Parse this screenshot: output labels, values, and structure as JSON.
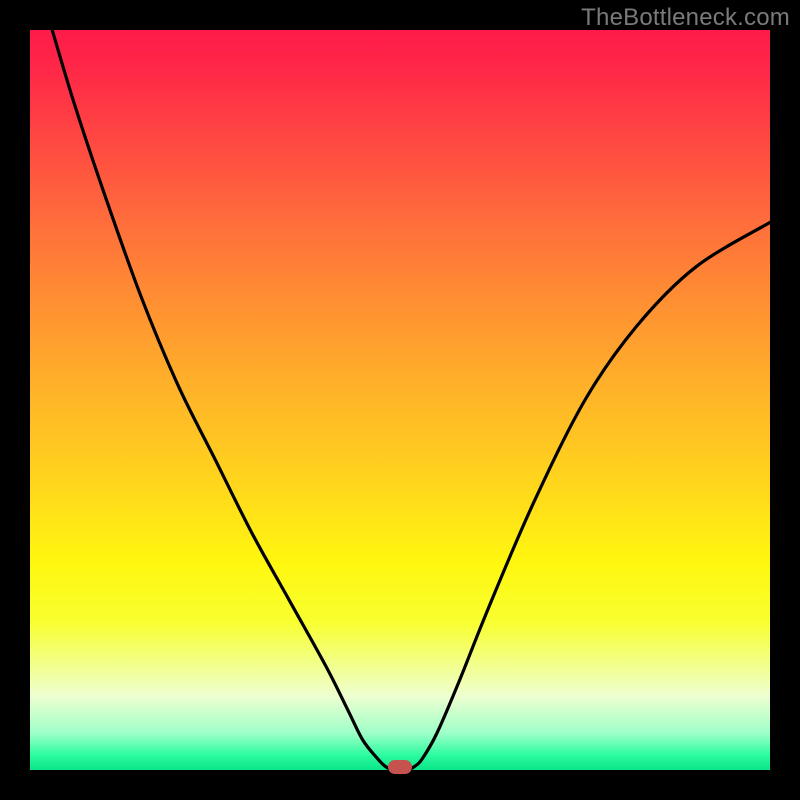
{
  "watermark": "TheBottleneck.com",
  "colors": {
    "frame": "#000000",
    "curve": "#000000",
    "marker": "#c5524f"
  },
  "chart_data": {
    "type": "line",
    "title": "",
    "xlabel": "",
    "ylabel": "",
    "xlim": [
      0,
      100
    ],
    "ylim": [
      0,
      100
    ],
    "grid": false,
    "legend": false,
    "series": [
      {
        "name": "bottleneck-curve",
        "x": [
          3,
          6,
          10,
          15,
          20,
          25,
          30,
          35,
          40,
          43,
          45,
          47,
          48,
          49,
          50,
          51,
          52,
          53,
          55,
          58,
          62,
          68,
          75,
          82,
          90,
          100
        ],
        "y": [
          100,
          90,
          78,
          64,
          52,
          42,
          32,
          23,
          14,
          8,
          4,
          1.5,
          0.5,
          0,
          0,
          0,
          0.5,
          1.5,
          5,
          12,
          22,
          36,
          50,
          60,
          68,
          74
        ]
      }
    ],
    "marker": {
      "x": 50,
      "y": 0
    },
    "background_gradient": {
      "type": "vertical",
      "stops": [
        {
          "pos": 0,
          "color": "#ff1a4a"
        },
        {
          "pos": 50,
          "color": "#ffd000"
        },
        {
          "pos": 80,
          "color": "#fff70f"
        },
        {
          "pos": 100,
          "color": "#0be488"
        }
      ]
    }
  }
}
